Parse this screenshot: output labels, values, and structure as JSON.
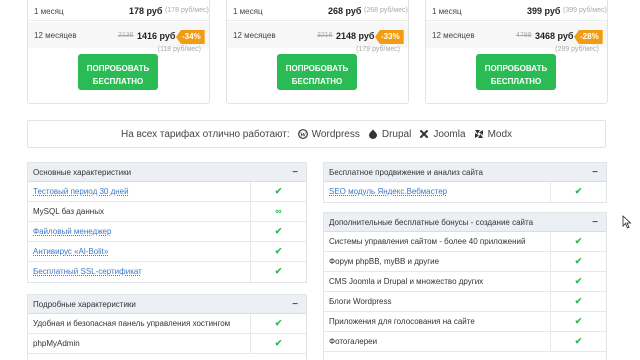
{
  "plans": [
    {
      "rows": [
        {
          "period": "1 месяц",
          "old": "",
          "price": "178 руб",
          "per_month": "(178 руб/мес)",
          "discount": ""
        },
        {
          "period": "12 месяцев",
          "old": "2136",
          "price": "1416 руб",
          "per_month": "(118 руб/мес)",
          "discount": "-34%"
        }
      ],
      "button": [
        "ПОПРОБОВАТЬ",
        "БЕСПЛАТНО"
      ]
    },
    {
      "rows": [
        {
          "period": "1 месяц",
          "old": "",
          "price": "268 руб",
          "per_month": "(268 руб/мес)",
          "discount": ""
        },
        {
          "period": "12 месяцев",
          "old": "3216",
          "price": "2148 руб",
          "per_month": "(179 руб/мес)",
          "discount": "-33%"
        }
      ],
      "button": [
        "ПОПРОБОВАТЬ",
        "БЕСПЛАТНО"
      ]
    },
    {
      "rows": [
        {
          "period": "1 месяц",
          "old": "",
          "price": "399 руб",
          "per_month": "(399 руб/мес)",
          "discount": ""
        },
        {
          "period": "12 месяцев",
          "old": "4788",
          "price": "3468 руб",
          "per_month": "(289 руб/мес)",
          "discount": "-28%"
        }
      ],
      "button": [
        "ПОПРОБОВАТЬ",
        "БЕСПЛАТНО"
      ]
    }
  ],
  "cms_bar": {
    "label": "На всех тарифах отлично работают:",
    "items": [
      "Wordpress",
      "Drupal",
      "Joomla",
      "Modx"
    ]
  },
  "panels": {
    "basic": {
      "title": "Основные характеристики",
      "rows": [
        {
          "name": "Тестовый период 30 дней",
          "link": true,
          "value": "✔"
        },
        {
          "name": "MySQL баз данных",
          "link": false,
          "value": "∞"
        },
        {
          "name": "Файловый менеджер",
          "link": true,
          "value": "✔"
        },
        {
          "name": "Антивирус «Al-Bolit»",
          "link": true,
          "value": "✔"
        },
        {
          "name": "Бесплатный SSL-сертификат",
          "link": true,
          "value": "✔"
        }
      ]
    },
    "detailed": {
      "title": "Подробные характеристики",
      "rows": [
        {
          "name": "Удобная и безопасная панель управления хостингом",
          "link": false,
          "value": "✔"
        },
        {
          "name": "phpMyAdmin",
          "link": false,
          "value": "✔"
        }
      ]
    },
    "promo": {
      "title": "Бесплатное продвижение и анализ сайта",
      "rows": [
        {
          "name": "SEO модуль Яндекс.Вебмастер",
          "link": true,
          "value": "✔"
        }
      ]
    },
    "bonus": {
      "title": "Дополнительные бесплатные бонусы - создание сайта",
      "rows": [
        {
          "name": "Системы управления сайтом - более 40 приложений",
          "link": false,
          "value": "✔"
        },
        {
          "name": "Форум phpBB, myBB и другие",
          "link": false,
          "value": "✔"
        },
        {
          "name": "CMS Joomla и Drupal и множество других",
          "link": false,
          "value": "✔"
        },
        {
          "name": "Блоги Wordpress",
          "link": false,
          "value": "✔"
        },
        {
          "name": "Приложения для голосования на сайте",
          "link": false,
          "value": "✔"
        },
        {
          "name": "Фотогалереи",
          "link": false,
          "value": "✔"
        }
      ]
    }
  },
  "collapse_symbol": "−",
  "colors": {
    "accent_green": "#2bbb55",
    "discount_orange": "#f39c12",
    "link_blue": "#3b79c9"
  }
}
